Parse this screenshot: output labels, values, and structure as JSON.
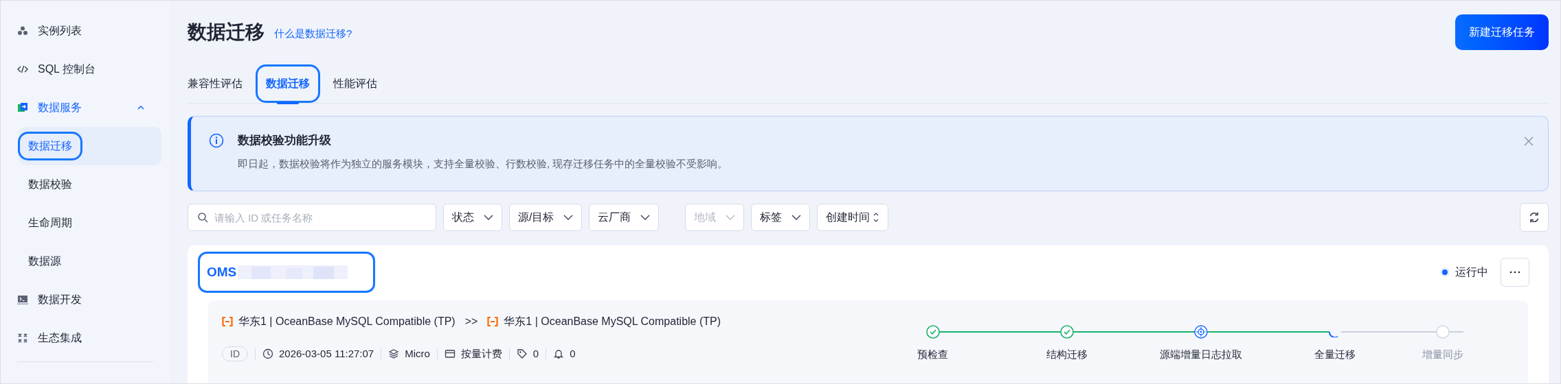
{
  "sidebar": {
    "items": [
      {
        "label": "实例列表",
        "selected": false
      },
      {
        "label": "SQL 控制台",
        "selected": false
      },
      {
        "label": "数据服务",
        "selected": false,
        "expanded": true,
        "children": [
          {
            "label": "数据迁移",
            "selected": true,
            "highlighted": true
          },
          {
            "label": "数据校验",
            "selected": false,
            "highlighted": false
          },
          {
            "label": "生命周期",
            "selected": false,
            "highlighted": false
          },
          {
            "label": "数据源",
            "selected": false,
            "highlighted": false
          }
        ]
      },
      {
        "label": "数据开发",
        "selected": false
      },
      {
        "label": "生态集成",
        "selected": false
      }
    ]
  },
  "header": {
    "title": "数据迁移",
    "help_link": "什么是数据迁移?",
    "primary_button": "新建迁移任务"
  },
  "tabs": [
    {
      "label": "兼容性评估",
      "selected": false,
      "highlighted": false
    },
    {
      "label": "数据迁移",
      "selected": true,
      "highlighted": true
    },
    {
      "label": "性能评估",
      "selected": false,
      "highlighted": false
    }
  ],
  "alert": {
    "title": "数据校验功能升级",
    "message": "即日起，数据校验将作为独立的服务模块，支持全量校验、行数校验, 现存迁移任务中的全量校验不受影响。"
  },
  "filters": {
    "search": {
      "placeholder": "请输入 ID 或任务名称"
    },
    "dropdowns": [
      {
        "label": "状态",
        "disabled": false,
        "kind": "select"
      },
      {
        "label": "源/目标",
        "disabled": false,
        "kind": "select"
      },
      {
        "label": "云厂商",
        "disabled": false,
        "kind": "select"
      },
      {
        "label": "地域",
        "disabled": true,
        "kind": "select"
      },
      {
        "label": "标签",
        "disabled": false,
        "kind": "select"
      },
      {
        "label": "创建时间",
        "disabled": false,
        "kind": "sort"
      }
    ]
  },
  "tasks": [
    {
      "name": "OMS",
      "name_redacted": true,
      "highlighted": true,
      "status": "运行中",
      "source": "华东1 | OceanBase MySQL Compatible (TP)",
      "separator": ">>",
      "target": "华东1 | OceanBase MySQL Compatible (TP)",
      "meta": {
        "id_badge": "ID",
        "created": "2026-03-05 11:27:07",
        "spec": "Micro",
        "billing": "按量计费",
        "tags": "0",
        "alerts": "0"
      },
      "steps": [
        {
          "label": "预检查",
          "kind": "done"
        },
        {
          "label": "结构迁移",
          "kind": "done"
        },
        {
          "label": "源端增量日志拉取",
          "kind": "active"
        },
        {
          "label": "全量迁移",
          "kind": "running"
        },
        {
          "label": "增量同步",
          "kind": "pending"
        }
      ]
    }
  ]
}
